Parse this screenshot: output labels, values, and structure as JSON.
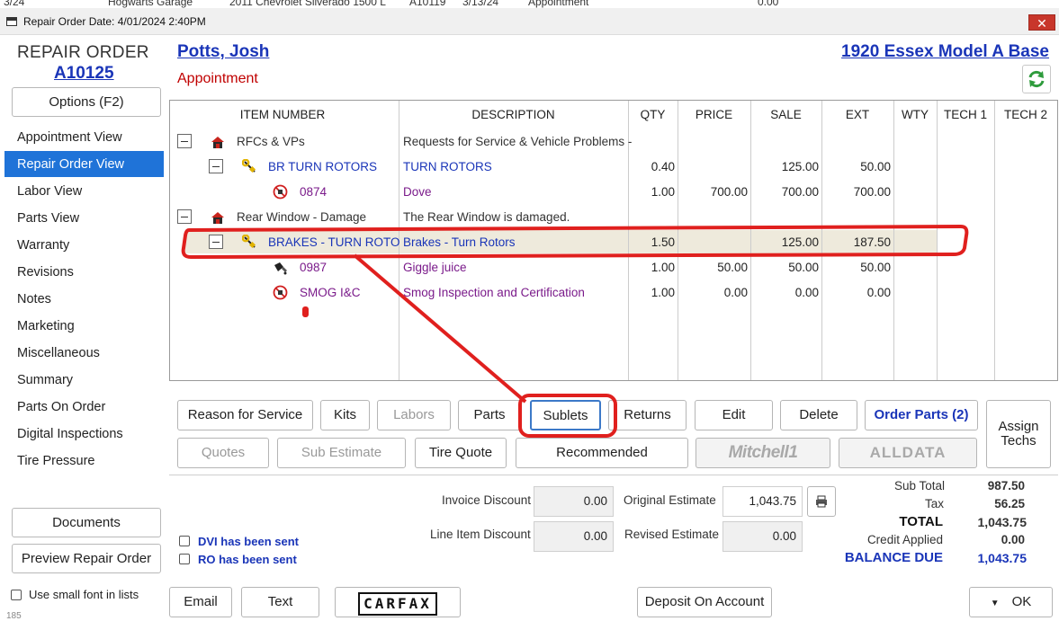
{
  "background_row": {
    "cells": [
      "3/24",
      "Hogwarts Garage",
      "2011 Chevrolet Silverado 1500 L",
      "A10119",
      "3/13/24",
      "Appointment",
      "0.00"
    ]
  },
  "window": {
    "title": "Repair Order Date:  4/01/2024  2:40PM",
    "close_glyph": "✕"
  },
  "left_panel": {
    "ro_label": "REPAIR ORDER",
    "ro_number": "A10125",
    "options_button": "Options (F2)",
    "nav": [
      "Appointment View",
      "Repair Order View",
      "Labor View",
      "Parts View",
      "Warranty",
      "Revisions",
      "Notes",
      "Marketing",
      "Miscellaneous",
      "Summary",
      "Parts On Order",
      "Digital Inspections",
      "Tire Pressure"
    ],
    "active_nav": "Repair Order View",
    "documents_button": "Documents",
    "preview_button": "Preview Repair Order",
    "small_font_label": "Use small font in lists",
    "version": "185"
  },
  "header": {
    "customer": "Potts, Josh",
    "status": "Appointment",
    "vehicle": "1920 Essex  Model A Base"
  },
  "grid": {
    "columns": [
      "ITEM NUMBER",
      "DESCRIPTION",
      "QTY",
      "PRICE",
      "SALE",
      "EXT",
      "WTY",
      "TECH 1",
      "TECH 2"
    ],
    "rows": [
      {
        "level": 0,
        "item": "RFCs & VPs",
        "desc": "Requests for Service & Vehicle Problems -",
        "qty": "",
        "price": "",
        "sale": "",
        "ext": "",
        "icon": "repair-shop-icon"
      },
      {
        "level": 1,
        "item": "BR TURN ROTORS",
        "desc": "TURN ROTORS",
        "qty": "0.40",
        "price": "",
        "sale": "125.00",
        "ext": "50.00",
        "icon": "wrench-icon"
      },
      {
        "level": 2,
        "item": "0874",
        "desc": "Dove",
        "qty": "1.00",
        "price": "700.00",
        "sale": "700.00",
        "ext": "700.00",
        "icon": "no-part-icon"
      },
      {
        "level": 0,
        "item": "Rear Window - Damage",
        "desc": "The Rear Window is damaged.",
        "qty": "",
        "price": "",
        "sale": "",
        "ext": "",
        "icon": "repair-shop-icon"
      },
      {
        "level": 1,
        "item": "BRAKES - TURN ROTO",
        "desc": "Brakes - Turn Rotors",
        "qty": "1.50",
        "price": "",
        "sale": "125.00",
        "ext": "187.50",
        "icon": "wrench-icon"
      },
      {
        "level": 2,
        "item": "0987",
        "desc": "Giggle juice",
        "qty": "1.00",
        "price": "50.00",
        "sale": "50.00",
        "ext": "50.00",
        "icon": "oil-can-icon"
      },
      {
        "level": 2,
        "item": "SMOG I&C",
        "desc": "Smog Inspection and Certification",
        "qty": "1.00",
        "price": "0.00",
        "sale": "0.00",
        "ext": "0.00",
        "icon": "no-part-icon"
      }
    ]
  },
  "toolbar": {
    "reason": "Reason for Service",
    "kits": "Kits",
    "labors": "Labors",
    "parts": "Parts",
    "sublets": "Sublets",
    "returns": "Returns",
    "edit": "Edit",
    "delete": "Delete",
    "order_parts": "Order Parts (2)",
    "assign_techs_1": "Assign",
    "assign_techs_2": "Techs",
    "quotes": "Quotes",
    "sub_estimate": "Sub Estimate",
    "tire_quote": "Tire Quote",
    "recommended": "Recommended",
    "mitchell": "Mitchell1",
    "alldata": "ALLDATA"
  },
  "totals": {
    "invoice_discount_label": "Invoice Discount",
    "invoice_discount": "0.00",
    "line_item_discount_label": "Line Item Discount",
    "line_item_discount": "0.00",
    "original_estimate_label": "Original Estimate",
    "original_estimate": "1,043.75",
    "revised_estimate_label": "Revised Estimate",
    "revised_estimate": "0.00",
    "dvi_sent": "DVI has been sent",
    "ro_sent": "RO has been sent",
    "sub_total_label": "Sub Total",
    "sub_total": "987.50",
    "tax_label": "Tax",
    "tax": "56.25",
    "total_label": "TOTAL",
    "total": "1,043.75",
    "credit_label": "Credit Applied",
    "credit": "0.00",
    "balance_label": "BALANCE DUE",
    "balance": "1,043.75"
  },
  "footer": {
    "email": "Email",
    "text": "Text",
    "carfax": "CARFAX",
    "deposit": "Deposit On Account",
    "ok": "OK"
  },
  "colors": {
    "link_blue": "#1a35b8",
    "active_nav": "#1f73d8",
    "status_red": "#c00000",
    "annotation_red": "#e0201e"
  }
}
